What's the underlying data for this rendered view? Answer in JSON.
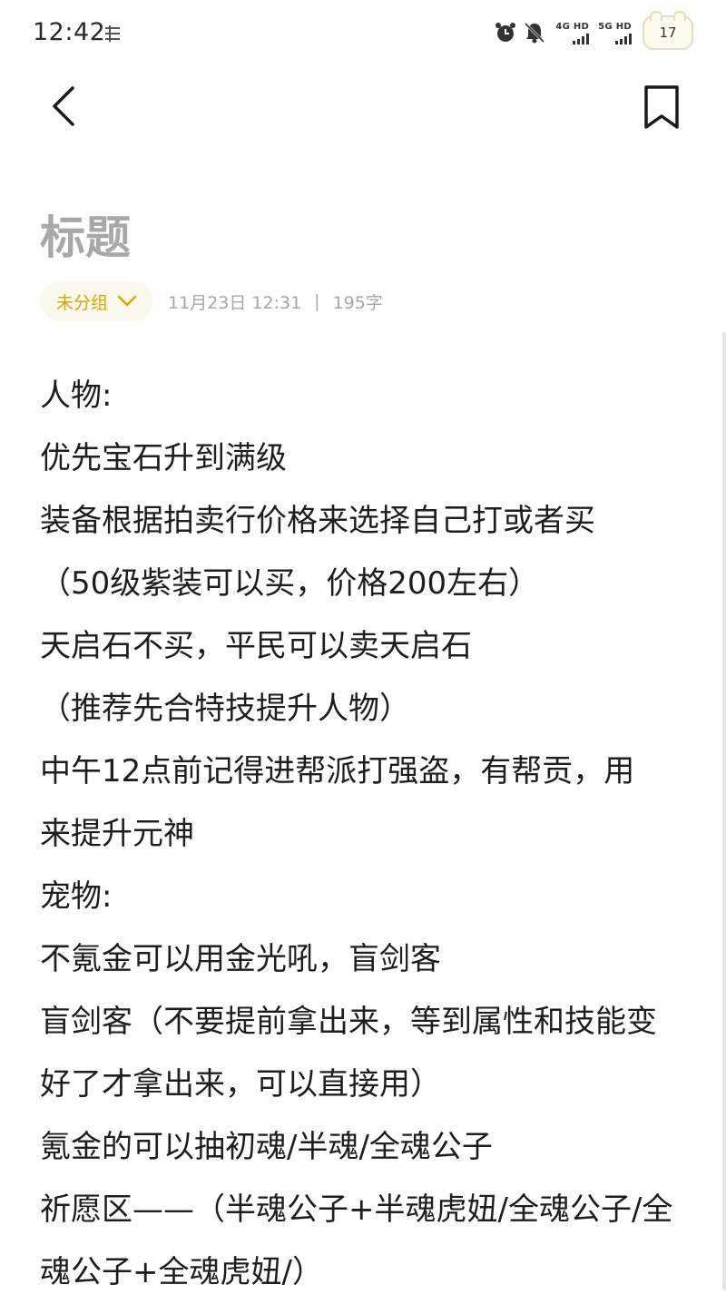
{
  "status_bar": {
    "time": "12:42",
    "network_1_label": "4G HD",
    "network_2_label": "5G HD",
    "battery_level": "17",
    "icons": [
      "notification-icon",
      "alarm-icon",
      "mute-bell-icon",
      "signal-icon",
      "battery-icon"
    ]
  },
  "nav": {
    "back_icon": "chevron-left-icon",
    "bookmark_icon": "bookmark-icon"
  },
  "note": {
    "title": "标题",
    "group_label": "未分组",
    "date": "11月23日 12:31",
    "separator": "|",
    "char_count": "195字",
    "lines": [
      "人物:",
      "优先宝石升到满级",
      "装备根据拍卖行价格来选择自己打或者买",
      "（50级紫装可以买，价格200左右）",
      "天启石不买，平民可以卖天启石",
      "（推荐先合特技提升人物）",
      "中午12点前记得进帮派打强盗，有帮贡，用",
      "来提升元神",
      "宠物:",
      "不氪金可以用金光吼，盲剑客",
      "盲剑客（不要提前拿出来，等到属性和技能变",
      "好了才拿出来，可以直接用）",
      "氪金的可以抽初魂/半魂/全魂公子",
      "祈愿区——（半魂公子+半魂虎妞/全魂公子/全",
      "魂公子+全魂虎妞/）"
    ]
  },
  "colors": {
    "accent": "#d9a500",
    "title_placeholder": "#a8a8a8",
    "meta_text": "#a6a6a6",
    "chip_bg": "#fbf8ee"
  }
}
